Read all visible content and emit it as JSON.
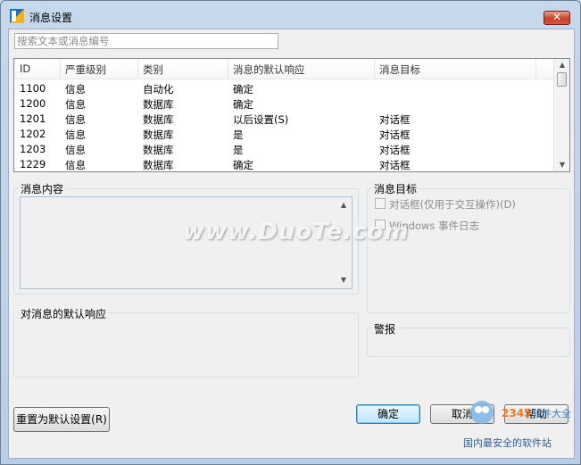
{
  "window": {
    "title": "消息设置",
    "close_label": "✕"
  },
  "search": {
    "placeholder": "搜索文本或消息编号",
    "value": ""
  },
  "table": {
    "columns": [
      "ID",
      "严重级别",
      "类别",
      "消息的默认响应",
      "消息目标"
    ],
    "rows": [
      [
        "1100",
        "信息",
        "自动化",
        "确定",
        ""
      ],
      [
        "1200",
        "信息",
        "数据库",
        "确定",
        ""
      ],
      [
        "1201",
        "信息",
        "数据库",
        "以后设置(S)",
        "对话框"
      ],
      [
        "1202",
        "信息",
        "数据库",
        "是",
        "对话框"
      ],
      [
        "1203",
        "信息",
        "数据库",
        "是",
        "对话框"
      ],
      [
        "1229",
        "信息",
        "数据库",
        "确定",
        "对话框"
      ]
    ]
  },
  "message_content": {
    "label": "消息内容",
    "value": ""
  },
  "message_target": {
    "label": "消息目标",
    "options": [
      {
        "label": "对话框(仅用于交互操作)(D)",
        "checked": false,
        "enabled": false
      },
      {
        "label": "Windows 事件日志",
        "checked": false,
        "enabled": false
      }
    ]
  },
  "default_response": {
    "label": "对消息的默认响应"
  },
  "alarm": {
    "label": "警报"
  },
  "buttons": {
    "reset": "重置为默认设置(R)",
    "ok": "确定",
    "cancel": "取消",
    "help": "帮助"
  },
  "watermark": {
    "text": "www.DuoTe.com"
  },
  "corner_brand": {
    "text": "国内最安全的软件站"
  }
}
